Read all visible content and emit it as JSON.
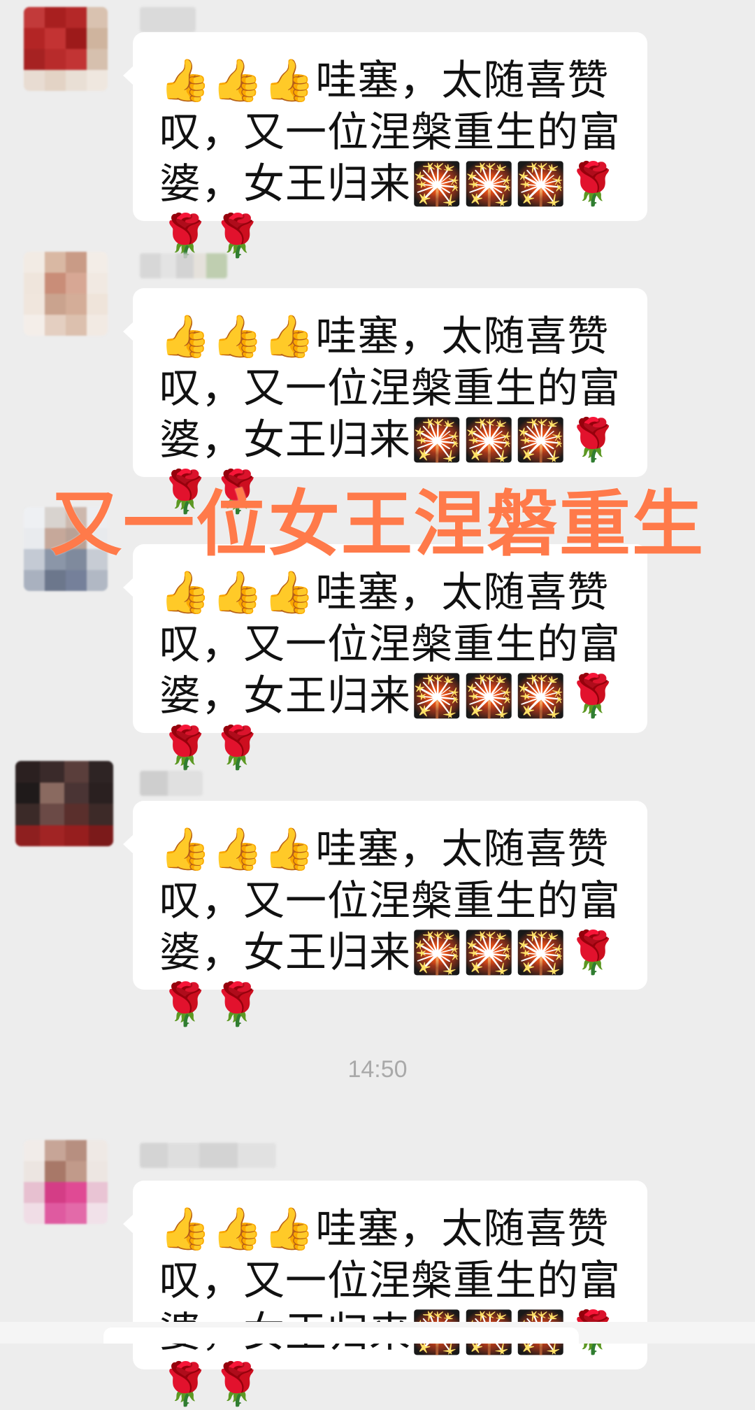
{
  "messages": [
    {
      "text": "👍👍👍哇塞，太随喜赞叹，又一位涅槃重生的富婆，女王归来🎇🎇🎇🌹🌹🌹"
    },
    {
      "text": "👍👍👍哇塞，太随喜赞叹，又一位涅槃重生的富婆，女王归来🎇🎇🎇🌹🌹🌹"
    },
    {
      "text": "👍👍👍哇塞，太随喜赞叹，又一位涅槃重生的富婆，女王归来🎇🎇🎇🌹🌹🌹"
    },
    {
      "text": "👍👍👍哇塞，太随喜赞叹，又一位涅槃重生的富婆，女王归来🎇🎇🎇🌹🌹🌹"
    },
    {
      "text": "👍👍👍哇塞，太随喜赞叹，又一位涅槃重生的富婆，女王归来🎇🎇🎇🌹🌹🌹"
    }
  ],
  "timestamp": "14:50",
  "overlay_caption": "又一位女王涅磐重生",
  "colors": {
    "background": "#ededed",
    "bubble": "#ffffff",
    "caption": "#ff7a4a",
    "timestamp": "#a9a9a9"
  }
}
